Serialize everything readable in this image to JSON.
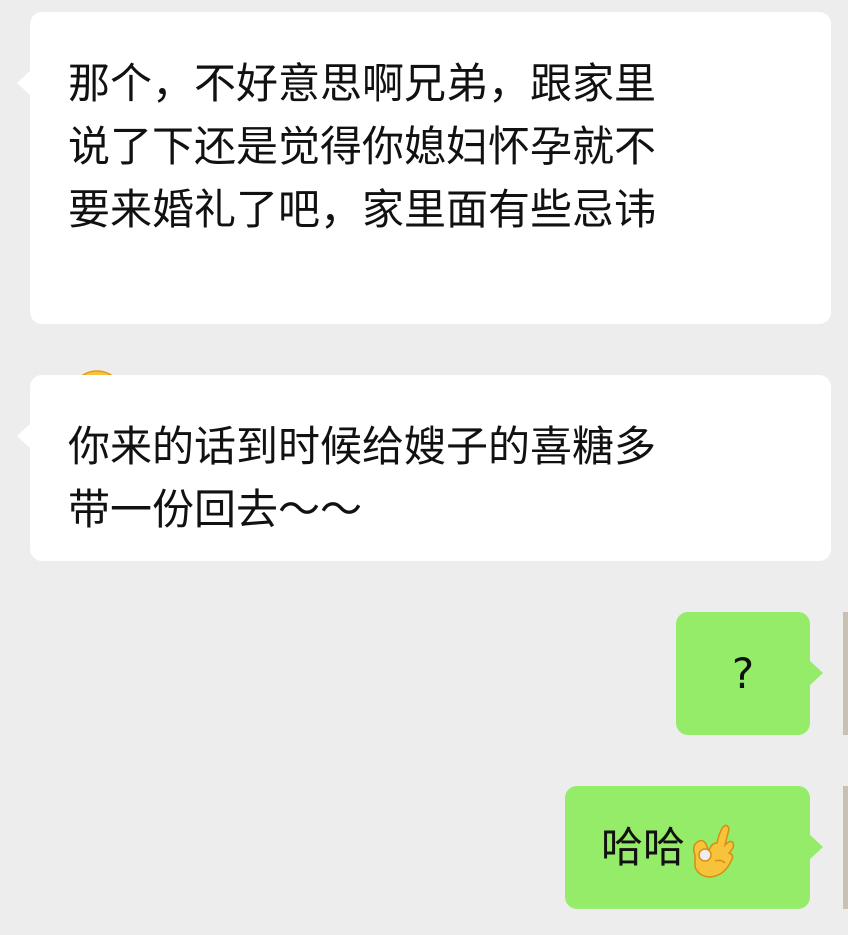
{
  "colors": {
    "background": "#ededed",
    "incoming_bubble": "#ffffff",
    "outgoing_bubble": "#95ec69",
    "text": "#111111"
  },
  "messages": [
    {
      "direction": "incoming",
      "lines": [
        "那个，不好意思啊兄弟，跟家里",
        "说了下还是觉得你媳妇怀孕就不",
        "要来婚礼了吧，家里面有些忌讳"
      ],
      "emoji": "facepalm-emoji-icon"
    },
    {
      "direction": "incoming",
      "lines": [
        "你来的话到时候给嫂子的喜糖多",
        "带一份回去～～"
      ]
    },
    {
      "direction": "outgoing",
      "text": "?"
    },
    {
      "direction": "outgoing",
      "text": "哈哈",
      "emoji": "ok-hand-emoji-icon"
    }
  ]
}
